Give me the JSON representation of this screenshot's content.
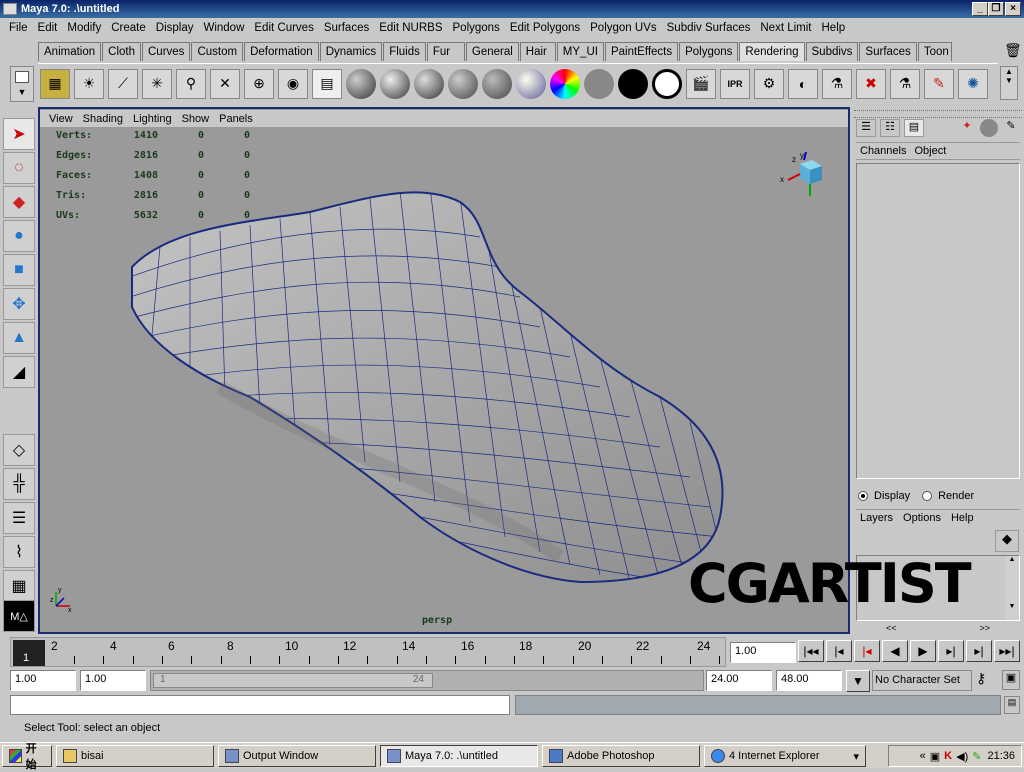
{
  "window": {
    "title": "Maya 7.0: .\\untitled",
    "min": "_",
    "restore": "❐",
    "close": "×"
  },
  "menubar": [
    "File",
    "Edit",
    "Modify",
    "Create",
    "Display",
    "Window",
    "Edit Curves",
    "Surfaces",
    "Edit NURBS",
    "Polygons",
    "Edit Polygons",
    "Polygon UVs",
    "Subdiv Surfaces",
    "Next Limit",
    "Help"
  ],
  "shelf_tabs": [
    "Animation",
    "Cloth",
    "Curves",
    "Custom",
    "Deformation",
    "Dynamics",
    "Fluids",
    "Fur",
    "General",
    "Hair",
    "MY_UI",
    "PaintEffects",
    "Polygons",
    "Rendering",
    "Subdivs",
    "Surfaces",
    "Toon"
  ],
  "active_shelf_tab": "Rendering",
  "viewport": {
    "menu": [
      "View",
      "Shading",
      "Lighting",
      "Show",
      "Panels"
    ],
    "hud": [
      {
        "label": "Verts:",
        "value": "1410",
        "a": "0",
        "b": "0"
      },
      {
        "label": "Edges:",
        "value": "2816",
        "a": "0",
        "b": "0"
      },
      {
        "label": "Faces:",
        "value": "1408",
        "a": "0",
        "b": "0"
      },
      {
        "label": "Tris:",
        "value": "2816",
        "a": "0",
        "b": "0"
      },
      {
        "label": "UVs:",
        "value": "5632",
        "a": "0",
        "b": "0"
      }
    ],
    "camera": "persp",
    "axis_labels": {
      "x": "x",
      "y": "y",
      "z": "z"
    }
  },
  "right_panel": {
    "tabs": [
      "Channels",
      "Object"
    ],
    "layer_mode": {
      "display": "Display",
      "render": "Render",
      "selected": "Display"
    },
    "layer_menu": [
      "Layers",
      "Options",
      "Help"
    ],
    "nav_left": "<<",
    "nav_right": ">>"
  },
  "timeline": {
    "ticks": [
      "2",
      "4",
      "6",
      "8",
      "10",
      "12",
      "14",
      "16",
      "18",
      "20",
      "22",
      "24"
    ],
    "current_frame": "1",
    "current_time_field": "1.00"
  },
  "range": {
    "start_time": "1.00",
    "playback_start": "1.00",
    "slider_start": "1",
    "slider_end": "24",
    "playback_end": "24.00",
    "end_time": "48.00",
    "character_set": "No Character Set"
  },
  "help_line": "Select Tool: select an object",
  "watermark": "CGARTIST",
  "taskbar": {
    "start": "开始",
    "tasks": [
      "bisai",
      "Output Window",
      "Maya 7.0: .\\untitled",
      "Adobe Photoshop",
      "4 Internet Explorer"
    ],
    "active_task": "Maya 7.0: .\\untitled",
    "clock": "21:36"
  },
  "colors": {
    "viewport_bg": "#9a9a9a",
    "wire": "#1a2a80",
    "frame": "#1a2a70",
    "title": "#0a246a"
  }
}
